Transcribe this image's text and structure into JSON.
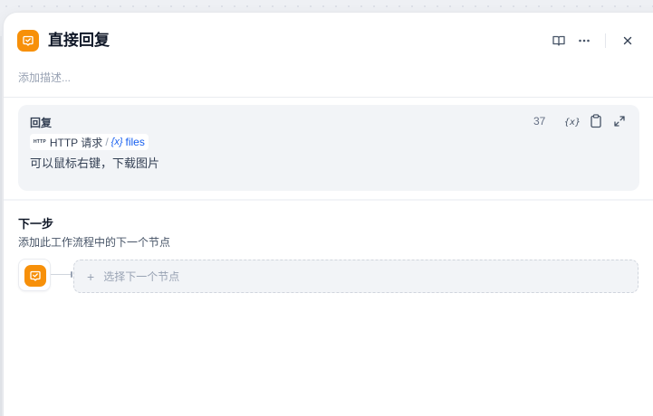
{
  "node": {
    "title": "直接回复",
    "description_placeholder": "添加描述...",
    "icon": "reply-icon",
    "accent_color": "#f79009"
  },
  "header_actions": [
    "book-icon",
    "more-icon",
    "close-icon"
  ],
  "reply": {
    "label": "回复",
    "char_count": "37",
    "variable_chip": {
      "node_type_tag": "HTTP",
      "node_name": "HTTP 请求",
      "separator": "/",
      "variable_icon": "{x}",
      "variable_name": "files"
    },
    "text": "可以鼠标右键，下载图片"
  },
  "next_step": {
    "title": "下一步",
    "description": "添加此工作流程中的下一个节点",
    "select_label": "选择下一个节点",
    "plus": "+"
  }
}
